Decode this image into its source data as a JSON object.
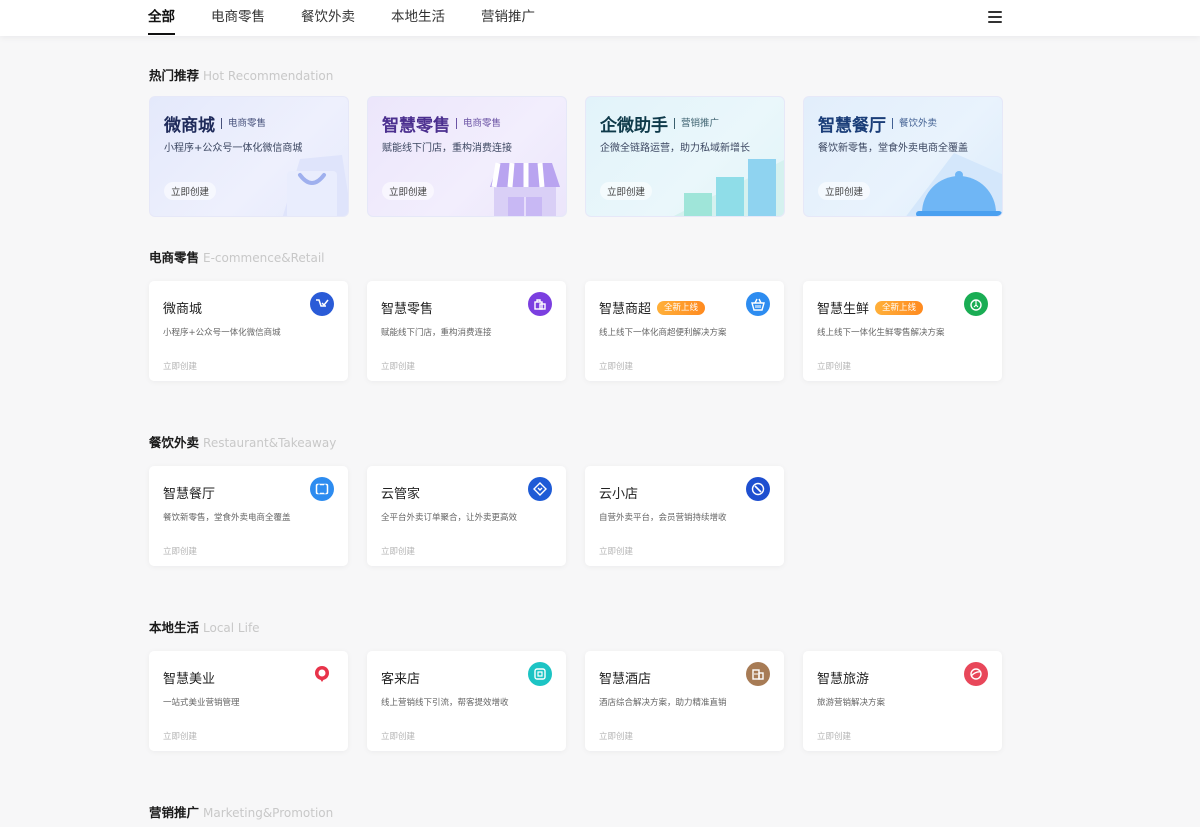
{
  "nav": {
    "tabs": [
      "全部",
      "电商零售",
      "餐饮外卖",
      "本地生活",
      "营销推广"
    ],
    "active_tab": "全部"
  },
  "sections": {
    "hot": {
      "title": "热门推荐",
      "en": "Hot Recommendation"
    },
    "ecommerce": {
      "title": "电商零售",
      "en": "E-commence&Retail"
    },
    "restaurant": {
      "title": "餐饮外卖",
      "en": "Restaurant&Takeaway"
    },
    "local": {
      "title": "本地生活",
      "en": "Local Life"
    },
    "marketing": {
      "title": "营销推广",
      "en": "Marketing&Promotion"
    }
  },
  "hot_cards": [
    {
      "title": "微商城",
      "tag": "电商零售",
      "desc": "小程序+公众号一体化微信商城",
      "button": "立即创建",
      "color": "#1e2a5a"
    },
    {
      "title": "智慧零售",
      "tag": "电商零售",
      "desc": "赋能线下门店，重构消费连接",
      "button": "立即创建",
      "color": "#4b2f8f"
    },
    {
      "title": "企微助手",
      "tag": "营销推广",
      "desc": "企微全链路运营，助力私域新增长",
      "button": "立即创建",
      "color": "#0f3a4a"
    },
    {
      "title": "智慧餐厅",
      "tag": "餐饮外卖",
      "desc": "餐饮新零售，堂食外卖电商全覆盖",
      "button": "立即创建",
      "color": "#1a3d78"
    }
  ],
  "ecommerce_cards": [
    {
      "title": "微商城",
      "desc": "小程序+公众号一体化微信商城",
      "button": "立即创建",
      "badge": "",
      "icon": "cart-icon",
      "icon_color": "#2a5bd7"
    },
    {
      "title": "智慧零售",
      "desc": "赋能线下门店，重构消费连接",
      "button": "立即创建",
      "badge": "",
      "icon": "shopping-bag-icon",
      "icon_color": "#7b3fe0"
    },
    {
      "title": "智慧商超",
      "desc": "线上线下一体化商超便利解决方案",
      "button": "立即创建",
      "badge": "全新上线",
      "icon": "basket-icon",
      "icon_color": "#2d8cf0"
    },
    {
      "title": "智慧生鲜",
      "desc": "线上线下一体化生鲜零售解决方案",
      "button": "立即创建",
      "badge": "全新上线",
      "icon": "fruit-icon",
      "icon_color": "#1aad54"
    }
  ],
  "restaurant_cards": [
    {
      "title": "智慧餐厅",
      "desc": "餐饮新零售，堂食外卖电商全覆盖",
      "button": "立即创建",
      "icon": "restaurant-icon",
      "icon_color": "#2d8cf0"
    },
    {
      "title": "云管家",
      "desc": "全平台外卖订单聚合，让外卖更高效",
      "button": "立即创建",
      "icon": "cloud-manager-icon",
      "icon_color": "#1e5bd6"
    },
    {
      "title": "云小店",
      "desc": "自营外卖平台，会员营销持续增收",
      "button": "立即创建",
      "icon": "cloud-shop-icon",
      "icon_color": "#1e4fd0"
    }
  ],
  "local_cards": [
    {
      "title": "智慧美业",
      "desc": "一站式美业营销管理",
      "button": "立即创建",
      "icon": "beauty-icon",
      "icon_color": "#e8334a"
    },
    {
      "title": "客来店",
      "desc": "线上营销线下引流，帮客提效增收",
      "button": "立即创建",
      "icon": "store-icon",
      "icon_color": "#1cc4c4"
    },
    {
      "title": "智慧酒店",
      "desc": "酒店综合解决方案，助力精准直销",
      "button": "立即创建",
      "icon": "hotel-icon",
      "icon_color": "#a77b55"
    },
    {
      "title": "智慧旅游",
      "desc": "旅游营销解决方案",
      "button": "立即创建",
      "icon": "travel-icon",
      "icon_color": "#e8475a"
    }
  ]
}
